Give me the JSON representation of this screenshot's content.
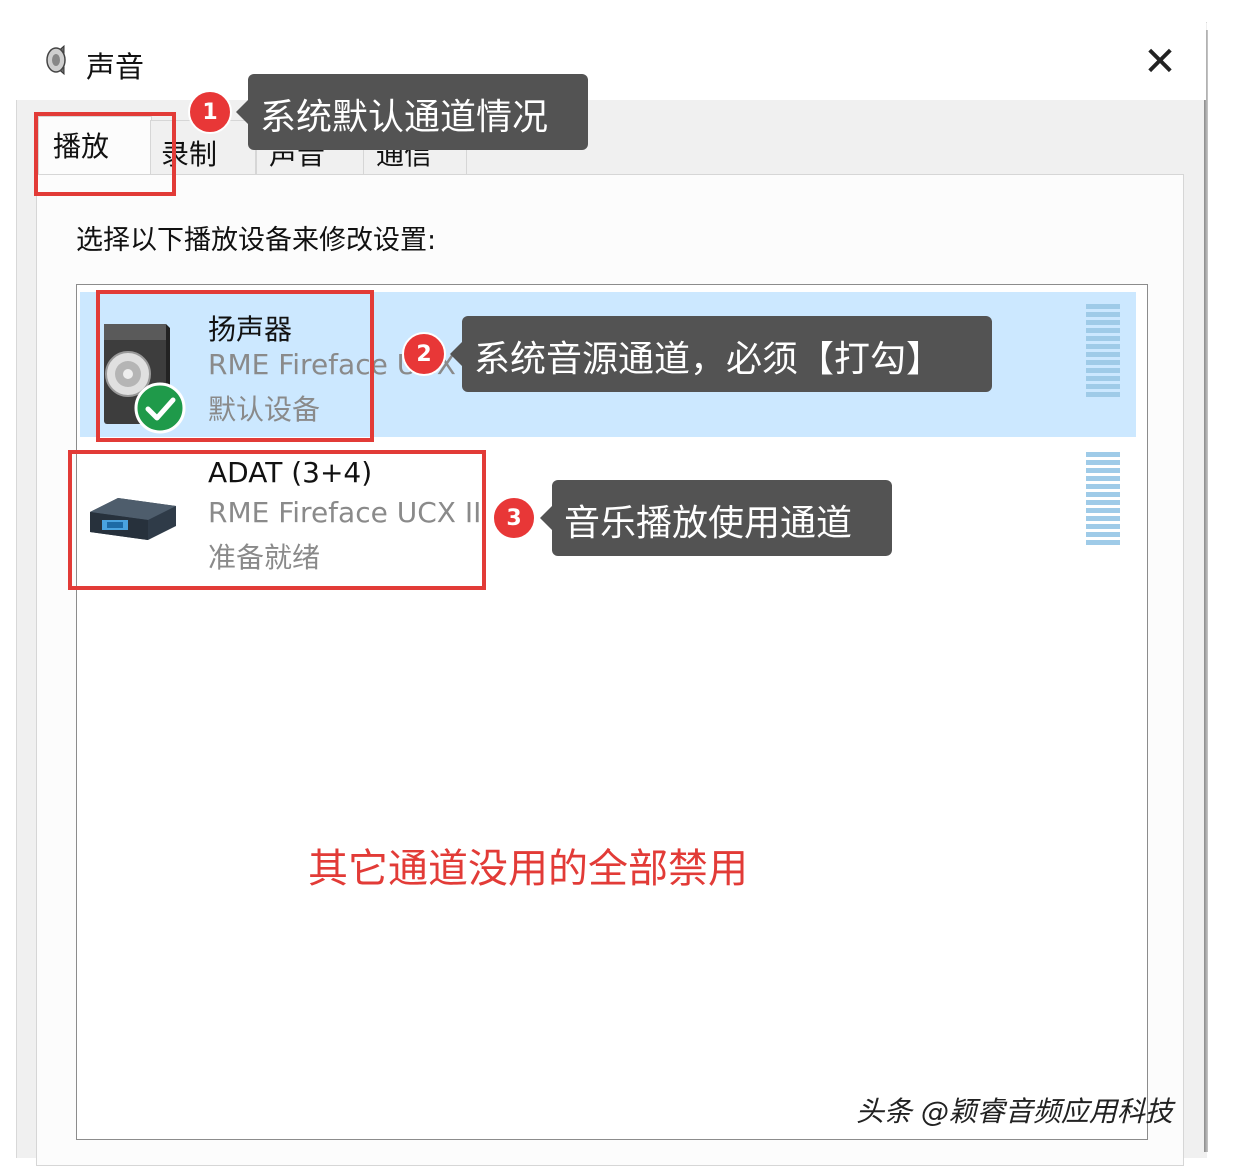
{
  "window": {
    "title": "声音",
    "close_glyph": "✕",
    "app_icon": "speaker-icon"
  },
  "tabs": [
    {
      "label": "播放",
      "active": true
    },
    {
      "label": "录制",
      "active": false
    },
    {
      "label": "声音",
      "active": false
    },
    {
      "label": "通信",
      "active": false
    }
  ],
  "instruction": "选择以下播放设备来修改设置:",
  "devices": [
    {
      "name": "扬声器",
      "driver": "RME Fireface UCX II",
      "status": "默认设备",
      "icon": "speaker-device-icon",
      "default_badge": "green-check-icon",
      "selected": true
    },
    {
      "name": "ADAT (3+4)",
      "driver": "RME Fireface UCX II",
      "status": "准备就绪",
      "icon": "digital-output-device-icon",
      "selected": false
    }
  ],
  "annotations": {
    "callout1": {
      "number": "1",
      "text": "系统默认通道情况"
    },
    "callout2": {
      "number": "2",
      "text": "系统音源通道，必须【打勾】"
    },
    "callout3": {
      "number": "3",
      "text": "音乐播放使用通道"
    },
    "red_note": "其它通道没用的全部禁用"
  },
  "watermark": "头条 @颖睿音频应用科技",
  "colors": {
    "annotation_red": "#e23b37",
    "callout_bg": "#535353",
    "selection_bg": "#cce8ff",
    "level_meter": "#9fcbe8",
    "check_green": "#1f9a4a"
  }
}
